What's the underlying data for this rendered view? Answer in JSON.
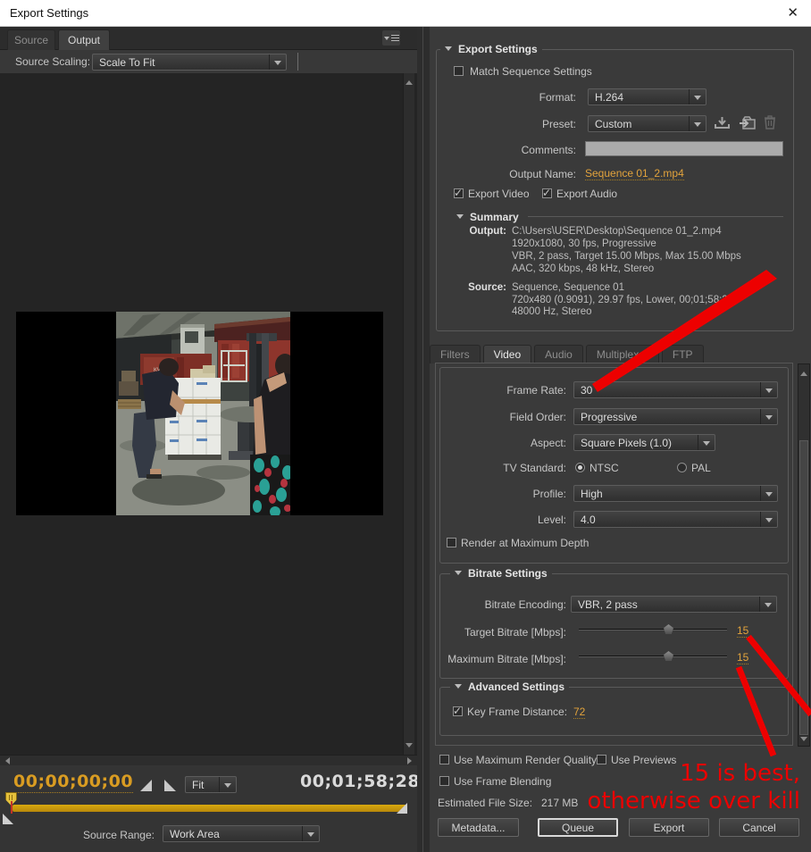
{
  "window": {
    "title": "Export Settings",
    "close_glyph": "✕"
  },
  "left": {
    "tabs": {
      "source": "Source",
      "output": "Output"
    },
    "source_scaling": {
      "label": "Source Scaling:",
      "value": "Scale To Fit"
    },
    "transport": {
      "current_time": "00;00;00;00",
      "zoom_level": "Fit",
      "duration": "00;01;58;28",
      "source_range": {
        "label": "Source Range:",
        "value": "Work Area"
      }
    }
  },
  "export": {
    "header": "Export Settings",
    "match_sequence": "Match Sequence Settings",
    "format": {
      "label": "Format:",
      "value": "H.264"
    },
    "preset": {
      "label": "Preset:",
      "value": "Custom"
    },
    "comments_label": "Comments:",
    "output_name": {
      "label": "Output Name:",
      "value": "Sequence 01_2.mp4"
    },
    "export_video": "Export Video",
    "export_audio": "Export Audio",
    "summary": {
      "header": "Summary",
      "output_label": "Output:",
      "output_lines": [
        "C:\\Users\\USER\\Desktop\\Sequence 01_2.mp4",
        "1920x1080, 30 fps, Progressive",
        "VBR, 2 pass, Target 15.00 Mbps, Max 15.00 Mbps",
        "AAC, 320 kbps, 48 kHz, Stereo"
      ],
      "source_label": "Source:",
      "source_lines": [
        "Sequence, Sequence 01",
        "720x480 (0.9091), 29.97 fps, Lower, 00;01;58;28",
        "48000 Hz, Stereo"
      ]
    }
  },
  "settings_tabs": {
    "filters": "Filters",
    "video": "Video",
    "audio": "Audio",
    "multiplexer": "Multiplexer",
    "ftp": "FTP"
  },
  "video": {
    "frame_rate": {
      "label": "Frame Rate:",
      "value": "30"
    },
    "field_order": {
      "label": "Field Order:",
      "value": "Progressive"
    },
    "aspect": {
      "label": "Aspect:",
      "value": "Square Pixels (1.0)"
    },
    "tv_standard": {
      "label": "TV Standard:",
      "ntsc": "NTSC",
      "pal": "PAL",
      "selected": "NTSC"
    },
    "profile": {
      "label": "Profile:",
      "value": "High"
    },
    "level": {
      "label": "Level:",
      "value": "4.0"
    },
    "render_max_depth": "Render at Maximum Depth"
  },
  "bitrate": {
    "header": "Bitrate Settings",
    "encoding": {
      "label": "Bitrate Encoding:",
      "value": "VBR, 2 pass"
    },
    "target": {
      "label": "Target Bitrate [Mbps]:",
      "value": "15"
    },
    "maximum": {
      "label": "Maximum Bitrate [Mbps]:",
      "value": "15"
    }
  },
  "advanced": {
    "header": "Advanced Settings",
    "key_frame": {
      "label": "Key Frame Distance:",
      "value": "72"
    }
  },
  "footer": {
    "use_max_render_quality": "Use Maximum Render Quality",
    "use_previews": "Use Previews",
    "use_frame_blending": "Use Frame Blending",
    "estimated_label": "Estimated File Size:",
    "estimated_value": "217 MB",
    "buttons": {
      "metadata": "Metadata...",
      "queue": "Queue",
      "export": "Export",
      "cancel": "Cancel"
    }
  },
  "annotation": {
    "line1": "15 is best,",
    "line2": "otherwise over kill",
    "color": "#ed0000"
  },
  "colors": {
    "accent_orange": "#e2a33c",
    "timeline_gold": "#c9990b",
    "panel_bg": "#3a3a3a"
  }
}
